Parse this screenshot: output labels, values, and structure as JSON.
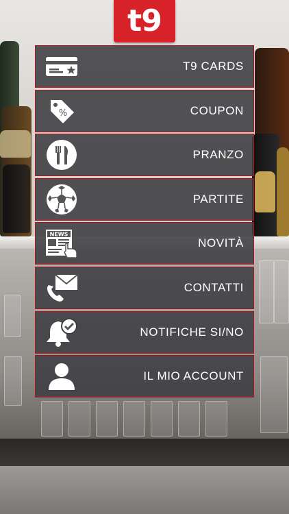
{
  "brand": {
    "logo_text": "t9",
    "logo_color": "#d8222a"
  },
  "accent_border": "#b5121b",
  "menu": {
    "items": [
      {
        "label": "T9 CARDS",
        "icon": "card-icon"
      },
      {
        "label": "COUPON",
        "icon": "coupon-tag-icon"
      },
      {
        "label": "PRANZO",
        "icon": "cutlery-icon"
      },
      {
        "label": "PARTITE",
        "icon": "soccer-ball-icon"
      },
      {
        "label": "NOVITÀ",
        "icon": "news-icon"
      },
      {
        "label": "CONTATTI",
        "icon": "contact-icon"
      },
      {
        "label": "NOTIFICHE SI/NO",
        "icon": "bell-check-icon"
      },
      {
        "label": "IL MIO ACCOUNT",
        "icon": "user-icon"
      }
    ]
  },
  "icon_text": {
    "news": "NEWS",
    "coupon": "%"
  }
}
